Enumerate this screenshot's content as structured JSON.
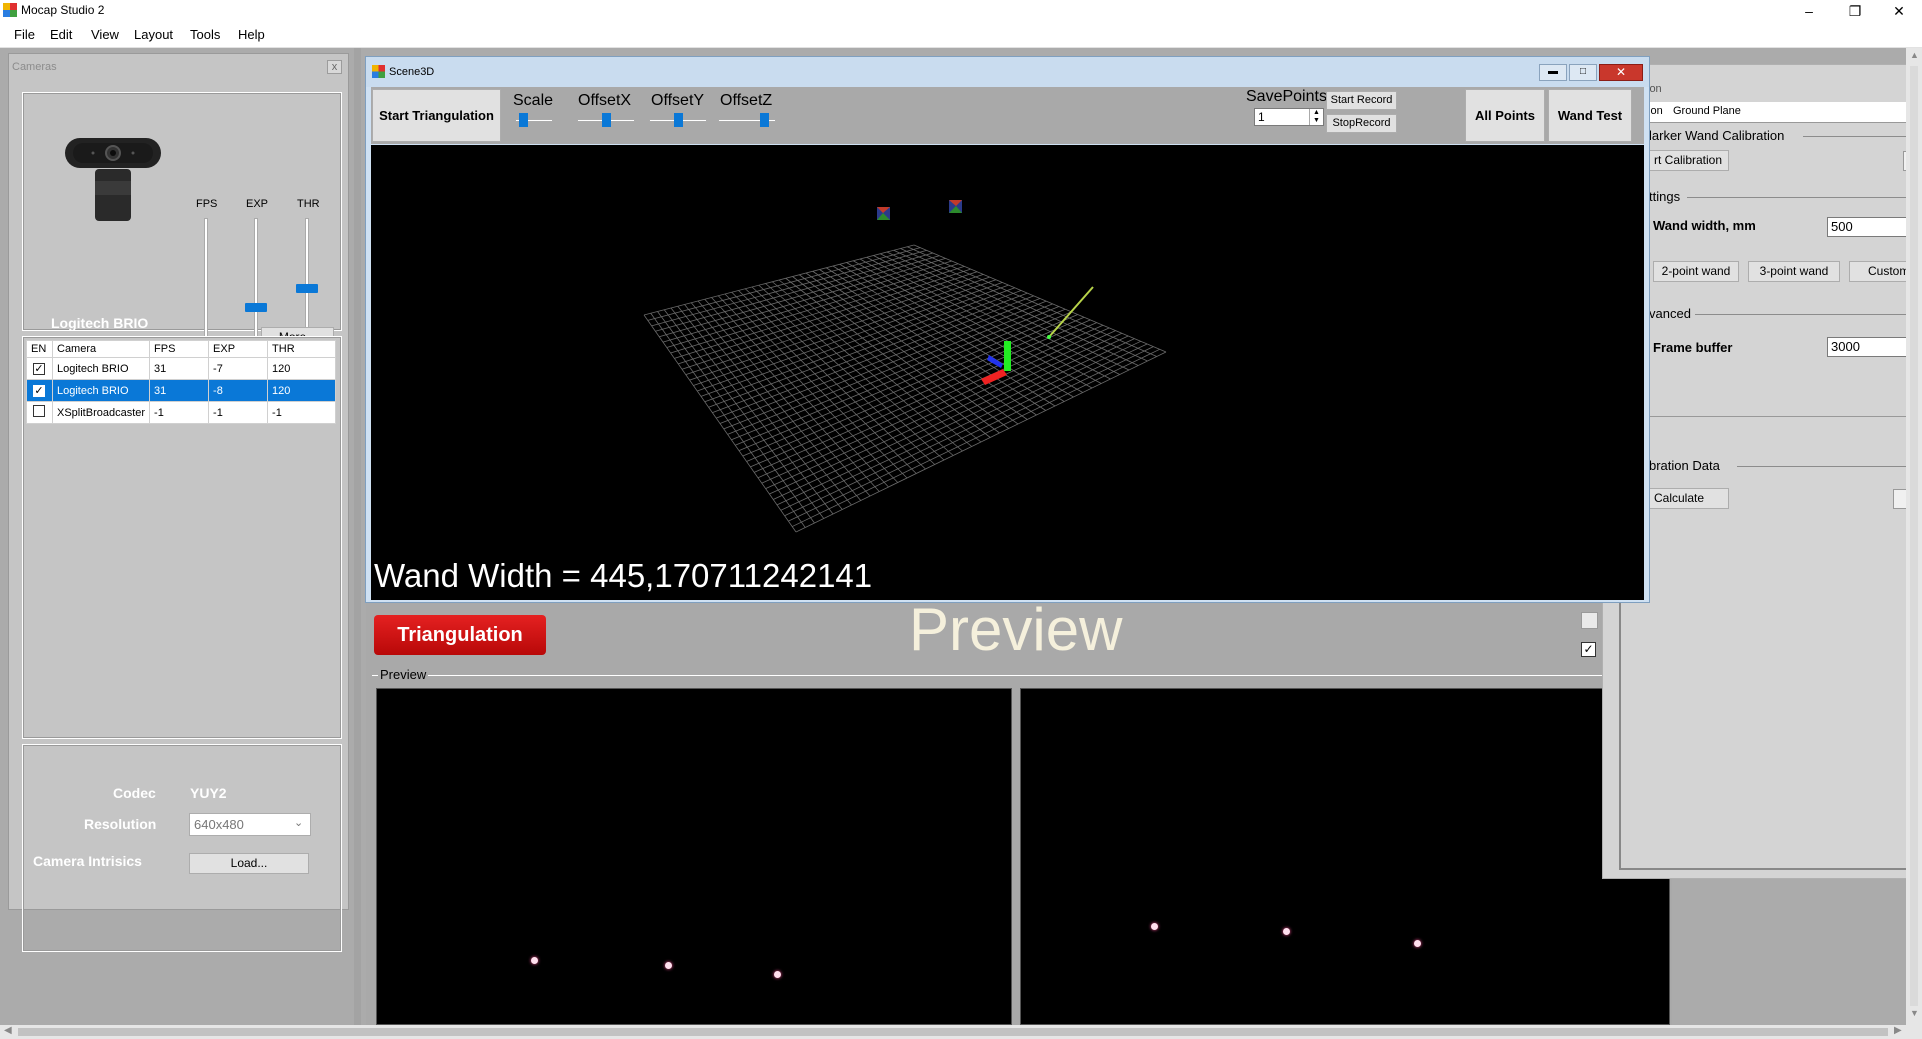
{
  "window": {
    "title": "Mocap Studio 2",
    "minimize": "–",
    "restore": "❐",
    "close": "✕"
  },
  "menu": [
    "File",
    "Edit",
    "View",
    "Layout",
    "Tools",
    "Help"
  ],
  "cameras_panel": {
    "caption": "Cameras",
    "close_label": "x",
    "selected_camera_name": "Logitech BRIO",
    "slider_labels": [
      "FPS",
      "EXP",
      "THR"
    ],
    "sliders": {
      "fps": 0.03,
      "exp": 0.35,
      "thr": 0.5
    },
    "more_button": "More...",
    "table": {
      "headers": [
        "EN",
        "Camera",
        "FPS",
        "EXP",
        "THR"
      ],
      "rows": [
        {
          "checked": true,
          "camera": "Logitech BRIO",
          "fps": "31",
          "exp": "-7",
          "thr": "120",
          "selected": false
        },
        {
          "checked": true,
          "camera": "Logitech BRIO",
          "fps": "31",
          "exp": "-8",
          "thr": "120",
          "selected": true
        },
        {
          "checked": false,
          "camera": "XSplitBroadcaster",
          "fps": "-1",
          "exp": "-1",
          "thr": "-1",
          "selected": false
        }
      ]
    },
    "codec_label": "Codec",
    "codec_value": "YUY2",
    "resolution_label": "Resolution",
    "resolution_value": "640x480",
    "intrinsics_label": "Camera Intrisics",
    "load_button": "Load..."
  },
  "scene3d": {
    "title": "Scene3D",
    "start_triangulation": "Start Triangulation",
    "sliders": [
      {
        "label": "Scale",
        "value": 0.15
      },
      {
        "label": "OffsetX",
        "value": 0.5
      },
      {
        "label": "OffsetY",
        "value": 0.5
      },
      {
        "label": "OffsetZ",
        "value": 0.85
      }
    ],
    "savepoints_label": "SavePoints",
    "savepoints_value": "1",
    "start_record": "Start Record",
    "stop_record": "StopRecord",
    "all_points": "All Points",
    "wand_test": "Wand Test",
    "overlay_text": "Wand Width = 445,170711242141"
  },
  "right_panel": {
    "tabs": [
      "tion",
      "Ground Plane"
    ],
    "marker_wand_group": "larker Wand Calibration",
    "start_calibration_button": "rt Calibration",
    "settings_group": "ttings",
    "wand_width_label": "Wand width, mm",
    "wand_width_value": "500",
    "two_point_wand": "2-point wand",
    "three_point_wand": "3-point wand",
    "custom_button": "Custom",
    "advanced_group": "vanced",
    "frame_buffer_label": "Frame buffer",
    "frame_buffer_value": "3000",
    "calibration_data_group": "bration Data",
    "calculate_button": "Calculate"
  },
  "main": {
    "triangulation_button": "Triangulation",
    "preview_heading": "Preview",
    "preview_group": "Preview"
  },
  "colors": {
    "accent": "#0a78d7",
    "triangulation_red": "#d40f0f",
    "preview_heading": "#f5f0dc"
  }
}
